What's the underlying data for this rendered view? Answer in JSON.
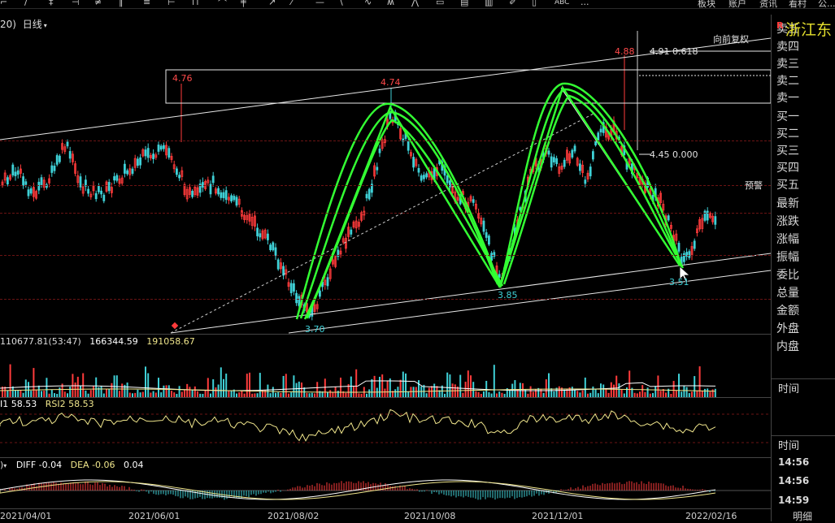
{
  "toolbar": {
    "icons": [
      "cursor-icon",
      "line-icon",
      "ray-icon",
      "segment-icon",
      "channel-icon",
      "parallel-icon",
      "fib-icon",
      "fan-icon",
      "cycle-icon",
      "arrow-icon",
      "rect-icon",
      "ellipse-icon",
      "arc-icon",
      "text-icon",
      "price-tag-icon",
      "flag-icon",
      "abc-icon",
      "more-icon"
    ],
    "right_items": [
      "板块",
      "账户",
      "资讯",
      "看村",
      "公..."
    ],
    "abc_label": "ABC",
    "more_label": "..."
  },
  "chart_header": {
    "prefix": "20)",
    "period": "日线"
  },
  "stock": {
    "name": "浙江东",
    "flag": "R"
  },
  "price_labels": {
    "p476": "4.76",
    "p474": "4.74",
    "p488": "4.88",
    "p385": "3.85",
    "p370": "3.70",
    "p351": "3.51"
  },
  "fib": {
    "top": "4.91  0.618",
    "mid": "4.45  0.000",
    "restore": "向前复权"
  },
  "warning_label": "预警",
  "order_book": {
    "labels": [
      "卖五",
      "卖四",
      "卖三",
      "卖二",
      "卖一",
      "买一",
      "买二",
      "买三",
      "买四",
      "买五",
      "最新",
      "涨跌",
      "涨幅",
      "振幅",
      "委比",
      "总量",
      "金额",
      "外盘",
      "内盘"
    ]
  },
  "volume_panel": {
    "text1": "110677.81(53:47)",
    "text2": "166344.59",
    "text3": "191058.67"
  },
  "rsi_panel": {
    "text1": "I1 58.53",
    "text2": "RSI2 58.53"
  },
  "macd_panel": {
    "prefix": ")",
    "diff": "DIFF -0.04",
    "dea": "DEA -0.06",
    "macd": "0.04"
  },
  "time_panel": {
    "label1": "时间",
    "label2": "时间",
    "times": [
      "14:56",
      "14:56",
      "14:59"
    ]
  },
  "dates": [
    "2021/04/01",
    "2021/06/01",
    "2021/08/02",
    "2021/10/08",
    "2021/12/01",
    "2022/02/16"
  ],
  "detail_tab": "明细",
  "colors": {
    "up": "#ff3b3b",
    "down": "#3fd0d6",
    "pattern": "#33ff33",
    "name": "#e5e02d"
  }
}
